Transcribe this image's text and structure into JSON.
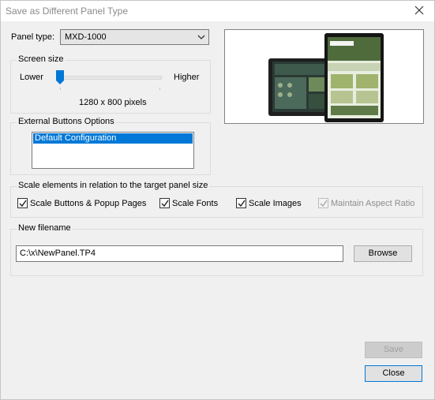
{
  "window": {
    "title": "Save as Different Panel Type"
  },
  "panel_type": {
    "label": "Panel type:",
    "value": "MXD-1000"
  },
  "screen_size": {
    "title": "Screen size",
    "lower_label": "Lower",
    "higher_label": "Higher",
    "resolution": "1280 x 800 pixels",
    "slider_fraction": 0.0
  },
  "external_buttons": {
    "title": "External Buttons Options",
    "items": [
      "Default Configuration"
    ],
    "selected_index": 0
  },
  "scale": {
    "title": "Scale elements in relation to the target panel size",
    "options": [
      {
        "label": "Scale Buttons & Popup Pages",
        "checked": true,
        "enabled": true
      },
      {
        "label": "Scale Fonts",
        "checked": true,
        "enabled": true
      },
      {
        "label": "Scale Images",
        "checked": true,
        "enabled": true
      },
      {
        "label": "Maintain Aspect Ratio",
        "checked": true,
        "enabled": false
      }
    ]
  },
  "new_filename": {
    "title": "New filename",
    "value": "C:\\x\\NewPanel.TP4",
    "browse_label": "Browse"
  },
  "buttons": {
    "save": "Save",
    "close": "Close"
  },
  "colors": {
    "selection": "#0078d7",
    "accent": "#0078d7"
  }
}
